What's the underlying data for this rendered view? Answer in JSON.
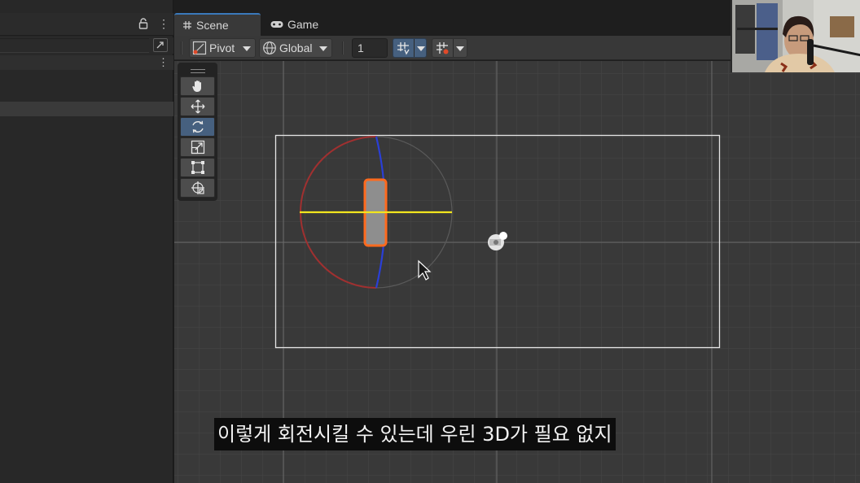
{
  "tabs": [
    {
      "label": "Scene",
      "icon": "hash-grid-icon",
      "active": true
    },
    {
      "label": "Game",
      "icon": "gamepad-icon",
      "active": false
    }
  ],
  "toolbar": {
    "pivot_label": "Pivot",
    "global_label": "Global",
    "grid_size_value": "1"
  },
  "tools": [
    {
      "name": "hand-tool",
      "icon": "hand-icon",
      "active": false
    },
    {
      "name": "move-tool",
      "icon": "move-arrows-icon",
      "active": false
    },
    {
      "name": "rotate-tool",
      "icon": "rotate-icon",
      "active": true
    },
    {
      "name": "scale-tool",
      "icon": "scale-icon",
      "active": false
    },
    {
      "name": "rect-tool",
      "icon": "rect-transform-icon",
      "active": false
    },
    {
      "name": "transform-tool",
      "icon": "transform-icon",
      "active": false
    }
  ],
  "subtitle": "이렇게 회전시킬 수 있는데 우린 3D가 필요 없지",
  "colors": {
    "accent": "#3a79bb",
    "selection_orange": "#ff6a1e",
    "rotate_x_axis_red": "#b53030",
    "rotate_z_axis_blue": "#2a3fd6",
    "rotate_y_axis_yellow": "#f2e51e",
    "camera_bounds": "#e6e6e6"
  }
}
